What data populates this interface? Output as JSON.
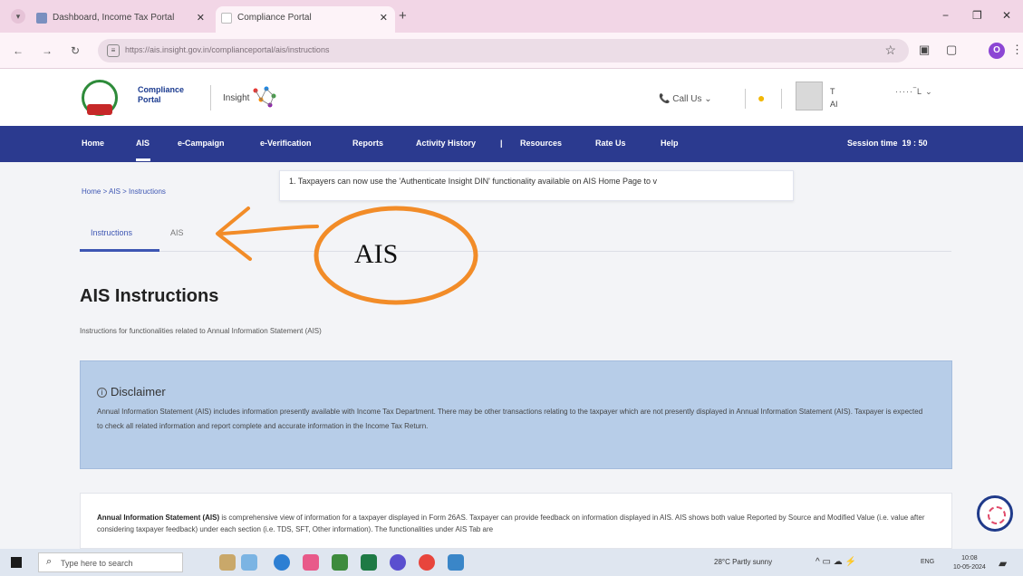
{
  "browser": {
    "tabs": [
      {
        "title": "Dashboard, Income Tax Portal"
      },
      {
        "title": "Compliance Portal"
      }
    ],
    "url": "https://ais.insight.gov.in/complianceportal/ais/instructions"
  },
  "header": {
    "portal_line1": "Compliance",
    "portal_line2": "Portal",
    "insight_label": "Insight",
    "call_us": "Call Us",
    "user_initial": "T",
    "user_sub": "AI"
  },
  "nav": {
    "items": [
      "Home",
      "AIS",
      "e-Campaign",
      "e-Verification",
      "Reports",
      "Activity History",
      "|",
      "Resources",
      "Rate Us",
      "Help"
    ],
    "session_label": "Session time",
    "session_value": "19 : 50"
  },
  "breadcrumb": "Home > AIS > Instructions",
  "ticker": "1. Taxpayers can now use the 'Authenticate Insight DIN' functionality available on AIS Home Page to v",
  "content_tabs": [
    "Instructions",
    "AIS"
  ],
  "annotation": {
    "label": "AIS",
    "color": "#f28c28"
  },
  "page": {
    "title": "AIS Instructions",
    "subtitle": "Instructions for functionalities related to Annual Information Statement (AIS)"
  },
  "disclaimer": {
    "title": "Disclaimer",
    "text": "Annual Information Statement (AIS) includes information presently available with Income Tax Department. There may be other transactions relating to the taxpayer which are not presently displayed in Annual Information Statement (AIS). Taxpayer is expected to check all related information and report complete and accurate information in the Income Tax Return."
  },
  "info": {
    "bold": "Annual Information Statement (AIS)",
    "text": " is comprehensive view of information for a taxpayer displayed in Form 26AS. Taxpayer can provide feedback on information displayed in AIS. AIS shows both value Reported by Source and Modified Value (i.e. value after considering taxpayer feedback) under each section (i.e. TDS, SFT, Other information). The functionalities under AIS Tab are"
  },
  "taskbar": {
    "search_placeholder": "Type here to search",
    "weather": "28°C  Partly sunny",
    "lang": "ENG",
    "time": "10:08",
    "date": "10-05-2024"
  },
  "colors": {
    "nav_bg": "#2b3a8f",
    "disclaimer_bg": "#b7cde8",
    "annotation": "#f28c28"
  }
}
